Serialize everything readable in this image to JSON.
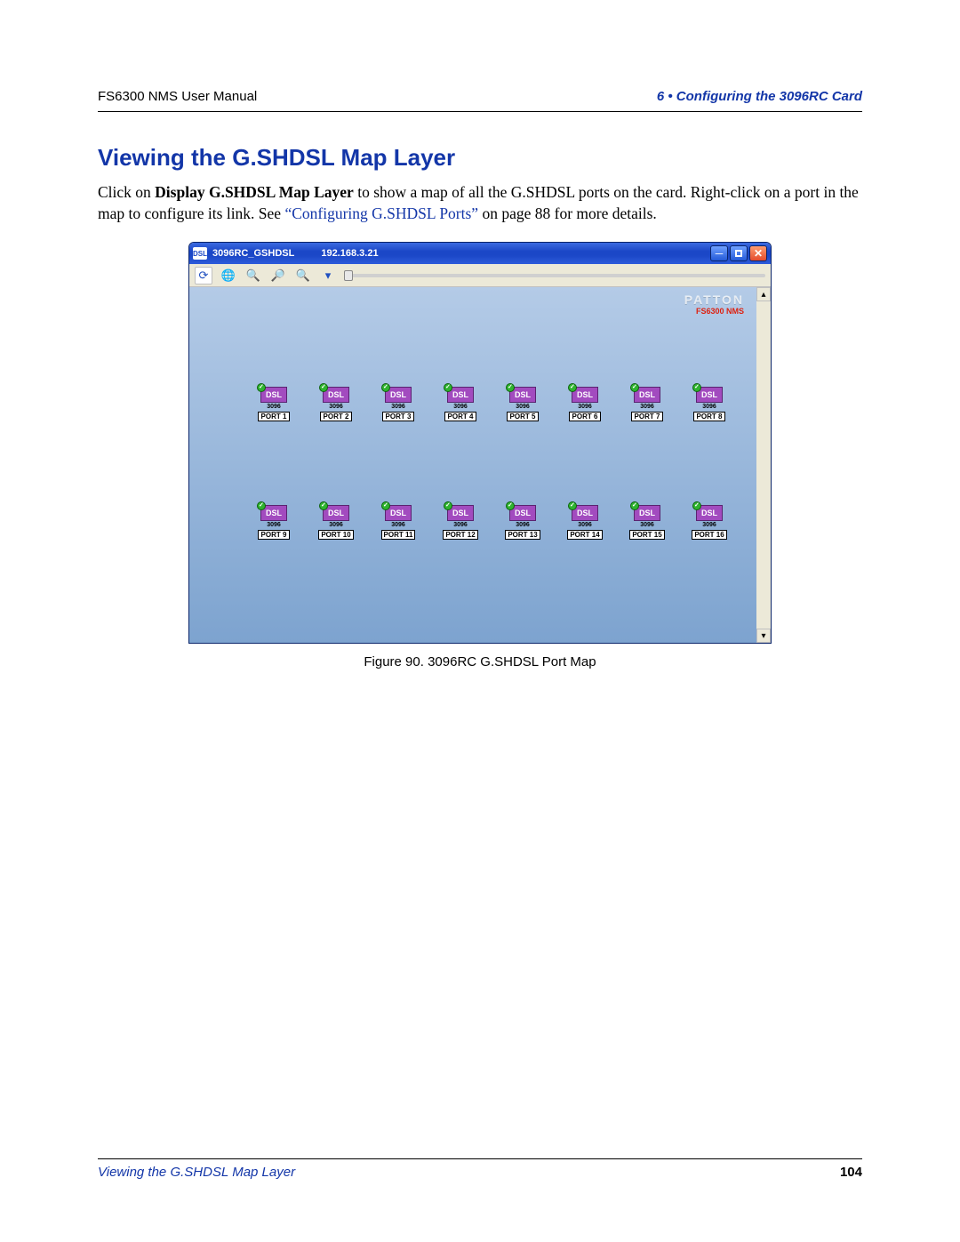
{
  "header": {
    "left": "FS6300 NMS User Manual",
    "right": "6 • Configuring the 3096RC Card"
  },
  "section": {
    "title": "Viewing the G.SHDSL Map Layer",
    "para_pre": "Click on ",
    "para_bold": "Display G.SHDSL Map Layer",
    "para_mid": " to show a map of all the G.SHDSL ports on the card. Right-click on a port in the map to configure its link. See ",
    "para_link": "“Configuring G.SHDSL Ports”",
    "para_post": " on page 88 for more details."
  },
  "window": {
    "icon_label": "DSL",
    "title": "3096RC_GSHDSL",
    "ip": "192.168.3.21",
    "brand": "PATTON",
    "brand_sub": "FS6300 NMS",
    "dsl_label": "DSL",
    "sub_id": "3096",
    "ports_row1": [
      "PORT 1",
      "PORT 2",
      "PORT 3",
      "PORT 4",
      "PORT 5",
      "PORT 6",
      "PORT 7",
      "PORT 8"
    ],
    "ports_row2": [
      "PORT 9",
      "PORT 10",
      "PORT 11",
      "PORT 12",
      "PORT 13",
      "PORT 14",
      "PORT 15",
      "PORT 16"
    ]
  },
  "figure": {
    "caption": "Figure 90. 3096RC G.SHDSL Port Map"
  },
  "footer": {
    "left": "Viewing the G.SHDSL Map Layer",
    "page": "104"
  }
}
